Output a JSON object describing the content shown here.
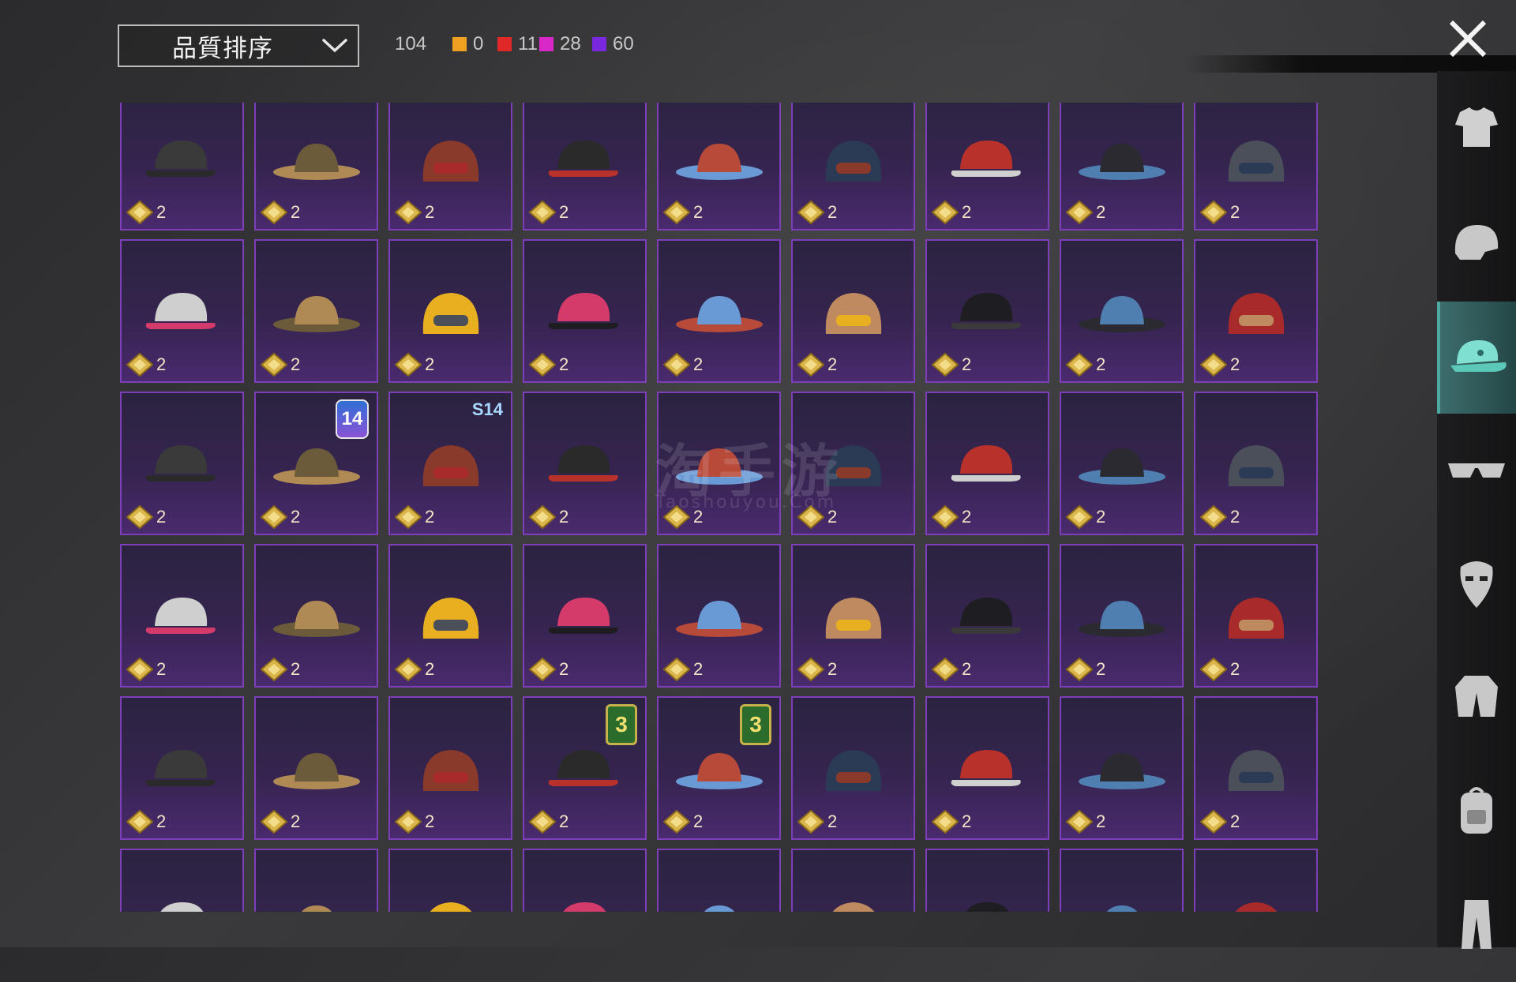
{
  "sort": {
    "label": "品質排序"
  },
  "inventory": {
    "count": "104",
    "qualities": [
      {
        "color": "#f0a020",
        "value": "0"
      },
      {
        "color": "#e02828",
        "value": "11"
      },
      {
        "color": "#d828c8",
        "value": "28"
      },
      {
        "color": "#7a28e0",
        "value": "60"
      }
    ]
  },
  "watermark": {
    "title": "淘手游",
    "subtitle": "Taoshouyou.Com"
  },
  "grid": {
    "cost": "2",
    "rows": [
      [
        "gas-mask-helmet",
        "military-helmet",
        "goggles-hair",
        "black-cap",
        "fox-ears",
        "beanie",
        "red-gold-cap",
        "witch-hat",
        "motor-helmet"
      ],
      [
        "flower-sombrero",
        "steampunk-hat",
        "racing-helmet-braids",
        "brown-hair",
        "navy-cap",
        "ski-goggles",
        "red-white-bandana",
        "rice-hat",
        "white-turban"
      ],
      [
        "clown-mask",
        "officer-cap",
        "knight-helmet",
        "pink-cap",
        "bunny-ears",
        "pink-beret",
        "aviator-cap",
        "black-cap",
        "football-helmet"
      ],
      [
        "white-visor",
        "scarecrow-hat",
        "yellow-bucket",
        "feather-hat",
        "straw-cone-hat",
        "black-mask",
        "shark-hood",
        "red-beret",
        "black-bowler"
      ],
      [
        "red-fedora",
        "shark-head",
        "flower-wreath",
        "black-fedora",
        "flower-crown",
        "cake-hat",
        "burger-hat",
        "headlamp",
        "blue-cap-hat"
      ],
      [
        "miner-cap",
        "blue-cap",
        "maroon-fedora",
        "captain-cap",
        "plaid-hood",
        "bucket-hat",
        "pilot-helmet",
        "flame-cap",
        "cowboy-hat"
      ]
    ],
    "tags": [
      {
        "row": 2,
        "col": 1,
        "type": "season",
        "text": "14"
      },
      {
        "row": 2,
        "col": 2,
        "type": "s14",
        "text": "S14"
      },
      {
        "row": 4,
        "col": 3,
        "type": "lvl",
        "text": "3"
      },
      {
        "row": 4,
        "col": 4,
        "type": "lvl",
        "text": "3"
      }
    ]
  },
  "sidebar": {
    "items": [
      "outfit-icon",
      "helmet-icon",
      "hat-icon",
      "glasses-icon",
      "mask-icon",
      "jacket-icon",
      "backpack-icon",
      "pants-icon"
    ],
    "active": "hat-icon"
  },
  "colors": {
    "card_border": "#7c3fb8",
    "accent": "#4fa9a0",
    "coin": "#d9b54a"
  }
}
